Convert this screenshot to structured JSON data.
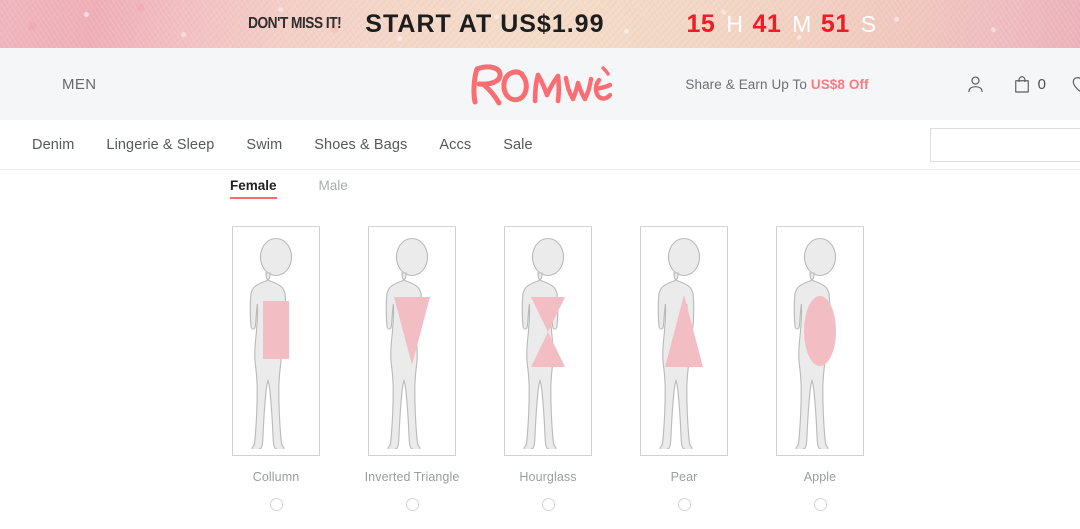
{
  "promo": {
    "lead_text": "DON'T MISS IT!",
    "main_text": "START AT US$1.99",
    "countdown": {
      "hours": "15",
      "hours_unit": "H",
      "minutes": "41",
      "minutes_unit": "M",
      "seconds": "51",
      "seconds_unit": "S"
    },
    "number_color": "#ef1c25",
    "unit_color": "#ffffff"
  },
  "header": {
    "men_link": "MEN",
    "brand": "ROMWE",
    "brand_color": "#fa6e73",
    "share_earn_prefix": "Share & Earn Up To ",
    "share_earn_highlight": "US$8 Off",
    "share_earn_color": "#fb7a7f",
    "icons": {
      "account": "user-icon",
      "bag": "shopping-bag-icon",
      "bag_count": "0",
      "wishlist": "heart-icon"
    }
  },
  "nav": {
    "items": [
      {
        "label": "Denim"
      },
      {
        "label": "Lingerie & Sleep"
      },
      {
        "label": "Swim"
      },
      {
        "label": "Shoes & Bags"
      },
      {
        "label": "Accs"
      },
      {
        "label": "Sale"
      }
    ],
    "search": {
      "value": "",
      "placeholder": ""
    }
  },
  "main": {
    "gender_tabs": [
      {
        "label": "Female",
        "active": true
      },
      {
        "label": "Male",
        "active": false
      }
    ],
    "shape_highlight_color": "#f3bec3",
    "body_fill_color": "#ebebeb",
    "body_stroke_color": "#b9b9b9",
    "shapes": [
      {
        "label": "Collumn",
        "shape": "rectangle",
        "selected": false
      },
      {
        "label": "Inverted Triangle",
        "shape": "inverted-triangle",
        "selected": false
      },
      {
        "label": "Hourglass",
        "shape": "hourglass",
        "selected": false
      },
      {
        "label": "Pear",
        "shape": "triangle",
        "selected": false
      },
      {
        "label": "Apple",
        "shape": "ellipse",
        "selected": false
      }
    ]
  }
}
